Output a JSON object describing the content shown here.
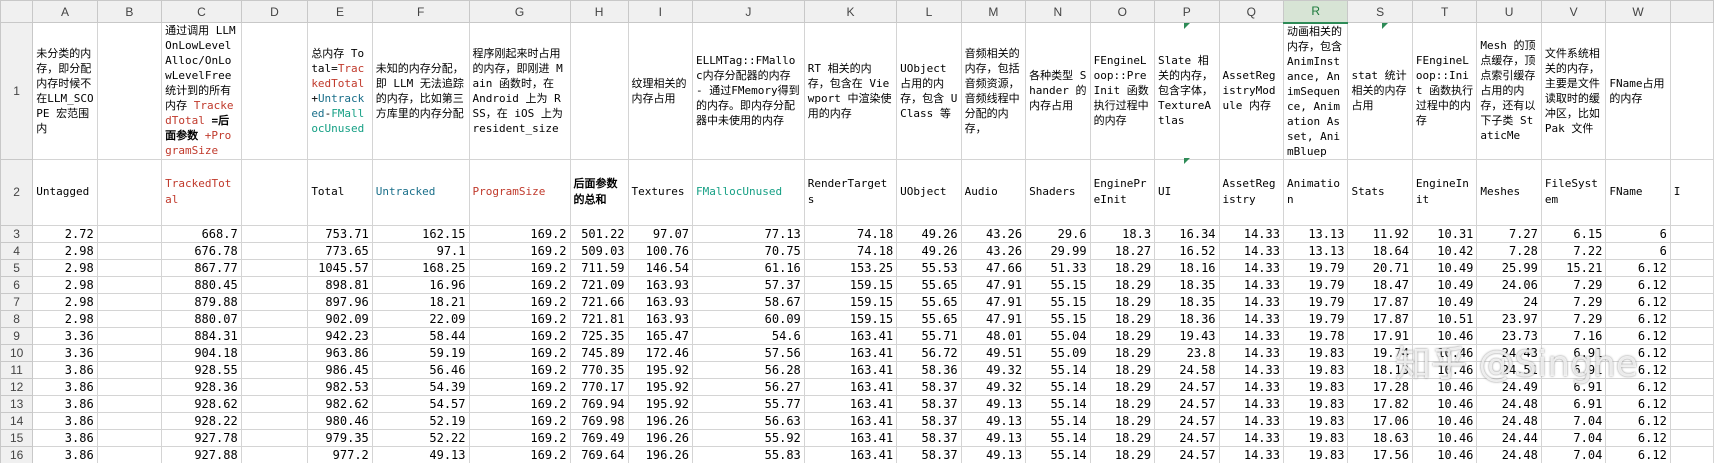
{
  "columns": [
    "A",
    "B",
    "C",
    "D",
    "E",
    "F",
    "G",
    "H",
    "I",
    "J",
    "K",
    "L",
    "M",
    "N",
    "O",
    "P",
    "Q",
    "R",
    "S",
    "T",
    "U",
    "V",
    "W",
    ""
  ],
  "row1": [
    {
      "text": "未分类的内存，即分配内存时候不在LLM_SCOPE 宏范围内"
    },
    {
      "text": ""
    },
    {
      "text": "通过调用 LLM OnLowLevelAlloc/OnLowLevelFree 统计到的所有内存",
      "parts": [
        {
          "t": "通过调用 LLM OnLowLevelAlloc/OnLowLevelFree 统计到的所有内存 ",
          "c": ""
        },
        {
          "t": "TrackedTotal",
          "c": "red"
        },
        {
          "t": " =后面参数",
          "c": "bold"
        },
        {
          "t": " +ProgramSize",
          "c": "red"
        }
      ]
    },
    {
      "text": ""
    },
    {
      "text": "",
      "parts": [
        {
          "t": "总内存 Total=",
          "c": ""
        },
        {
          "t": "TrackedTotal",
          "c": "red"
        },
        {
          "t": "+",
          "c": ""
        },
        {
          "t": "Untracked",
          "c": "teal"
        },
        {
          "t": "-",
          "c": ""
        },
        {
          "t": "FMallocUnused",
          "c": "green"
        }
      ]
    },
    {
      "text": "未知的内存分配，即 LLM 无法追踪的内存，比如第三方库里的内存分配"
    },
    {
      "text": "程序刚起来时占用的内存，即刚进 Main 函数时，在 Android 上为 RSS，在 iOS 上为 resident_size"
    },
    {
      "text": ""
    },
    {
      "text": "纹理相关的内存占用"
    },
    {
      "text": "ELLMTag::FMalloc内存分配器的内存 - 通过FMemory得到的内存。即内存分配器中未使用的内存"
    },
    {
      "text": " RT 相关的内存，包含在 Viewport 中渲染使用的内存"
    },
    {
      "text": "UObject 占用的内存，包含 UClass 等"
    },
    {
      "text": "音频相关的内存，包括音频资源，音频线程中分配的内存，"
    },
    {
      "text": "各种类型 Shander 的内存占用"
    },
    {
      "text": "FEngineLoop::PreInit 函数执行过程中的内存"
    },
    {
      "text": "Slate 相关的内存，包含字体，TextureAtlas"
    },
    {
      "text": "AssetRegistryModule 内存"
    },
    {
      "text": "动画相关的内存，包含 AnimInstance, AnimSequence, Animation Asset, AnimBluep"
    },
    {
      "text": "stat 统计相关的内存占用"
    },
    {
      "text": "FEngineLoop::Init 函数执行过程中的内存"
    },
    {
      "text": " Mesh 的顶点缓存，顶点索引缓存占用的内存，还有以下子类 StaticMe"
    },
    {
      "text": "文件系统相关的内存，主要是文件读取时的缓冲区，比如Pak 文件"
    },
    {
      "text": "FName占用的内存"
    },
    {
      "text": ""
    }
  ],
  "row2": [
    {
      "text": "Untagged",
      "c": ""
    },
    {
      "text": "",
      "c": ""
    },
    {
      "text": "TrackedTotal",
      "c": "red"
    },
    {
      "text": "",
      "c": ""
    },
    {
      "text": "Total",
      "c": ""
    },
    {
      "text": "Untracked",
      "c": "teal"
    },
    {
      "text": "ProgramSize",
      "c": "red"
    },
    {
      "text": "后面参数的总和",
      "c": "bold"
    },
    {
      "text": "Textures",
      "c": ""
    },
    {
      "text": "FMallocUnused",
      "c": "green"
    },
    {
      "text": "RenderTargets",
      "c": ""
    },
    {
      "text": "UObject",
      "c": ""
    },
    {
      "text": "Audio",
      "c": ""
    },
    {
      "text": "Shaders",
      "c": ""
    },
    {
      "text": "EnginePreInit",
      "c": ""
    },
    {
      "text": "UI",
      "c": ""
    },
    {
      "text": "AssetRegistry",
      "c": ""
    },
    {
      "text": "Animation",
      "c": ""
    },
    {
      "text": "Stats",
      "c": ""
    },
    {
      "text": "EngineInit",
      "c": ""
    },
    {
      "text": "Meshes",
      "c": ""
    },
    {
      "text": "FileSystem",
      "c": ""
    },
    {
      "text": "FName",
      "c": ""
    },
    {
      "text": "I",
      "c": ""
    }
  ],
  "rows": [
    {
      "n": "3",
      "cells": [
        "2.72",
        "",
        "668.7",
        "",
        "753.71",
        "162.15",
        "169.2",
        "501.22",
        "97.07",
        "77.13",
        "74.18",
        "49.26",
        "43.26",
        "29.6",
        "18.3",
        "16.34",
        "14.33",
        "13.13",
        "11.92",
        "10.31",
        "7.27",
        "6.15",
        "6",
        ""
      ]
    },
    {
      "n": "4",
      "cells": [
        "2.98",
        "",
        "676.78",
        "",
        "773.65",
        "97.1",
        "169.2",
        "509.03",
        "100.76",
        "70.75",
        "74.18",
        "49.26",
        "43.26",
        "29.99",
        "18.27",
        "16.52",
        "14.33",
        "13.13",
        "18.64",
        "10.42",
        "7.28",
        "7.22",
        "6",
        ""
      ]
    },
    {
      "n": "5",
      "cells": [
        "2.98",
        "",
        "867.77",
        "",
        "1045.57",
        "168.25",
        "169.2",
        "711.59",
        "146.54",
        "61.16",
        "153.25",
        "55.53",
        "47.66",
        "51.33",
        "18.29",
        "18.16",
        "14.33",
        "19.79",
        "20.71",
        "10.49",
        "25.99",
        "15.21",
        "6.12",
        ""
      ]
    },
    {
      "n": "6",
      "cells": [
        "2.98",
        "",
        "880.45",
        "",
        "898.81",
        "16.96",
        "169.2",
        "721.09",
        "163.93",
        "57.37",
        "159.15",
        "55.65",
        "47.91",
        "55.15",
        "18.29",
        "18.35",
        "14.33",
        "19.79",
        "18.47",
        "10.49",
        "24.06",
        "7.29",
        "6.12",
        ""
      ]
    },
    {
      "n": "7",
      "cells": [
        "2.98",
        "",
        "879.88",
        "",
        "897.96",
        "18.21",
        "169.2",
        "721.66",
        "163.93",
        "58.67",
        "159.15",
        "55.65",
        "47.91",
        "55.15",
        "18.29",
        "18.35",
        "14.33",
        "19.79",
        "17.87",
        "10.49",
        "24",
        "7.29",
        "6.12",
        ""
      ]
    },
    {
      "n": "8",
      "cells": [
        "2.98",
        "",
        "880.07",
        "",
        "902.09",
        "22.09",
        "169.2",
        "721.81",
        "163.93",
        "60.09",
        "159.15",
        "55.65",
        "47.91",
        "55.15",
        "18.29",
        "18.36",
        "14.33",
        "19.79",
        "17.87",
        "10.51",
        "23.97",
        "7.29",
        "6.12",
        ""
      ]
    },
    {
      "n": "9",
      "cells": [
        "3.36",
        "",
        "884.31",
        "",
        "942.23",
        "58.44",
        "169.2",
        "725.35",
        "165.47",
        "54.6",
        "163.41",
        "55.71",
        "48.01",
        "55.04",
        "18.29",
        "19.43",
        "14.33",
        "19.78",
        "17.91",
        "10.46",
        "23.73",
        "7.16",
        "6.12",
        ""
      ]
    },
    {
      "n": "10",
      "cells": [
        "3.36",
        "",
        "904.18",
        "",
        "963.86",
        "59.19",
        "169.2",
        "745.89",
        "172.46",
        "57.56",
        "163.41",
        "56.72",
        "49.51",
        "55.09",
        "18.29",
        "23.8",
        "14.33",
        "19.83",
        "19.74",
        "10.46",
        "24.43",
        "6.91",
        "6.12",
        ""
      ]
    },
    {
      "n": "11",
      "cells": [
        "3.86",
        "",
        "928.55",
        "",
        "986.45",
        "56.46",
        "169.2",
        "770.35",
        "195.92",
        "56.28",
        "163.41",
        "58.36",
        "49.32",
        "55.14",
        "18.29",
        "24.58",
        "14.33",
        "19.83",
        "18.13",
        "10.46",
        "24.51",
        "6.91",
        "6.12",
        ""
      ]
    },
    {
      "n": "12",
      "cells": [
        "3.86",
        "",
        "928.36",
        "",
        "982.53",
        "54.39",
        "169.2",
        "770.17",
        "195.92",
        "56.27",
        "163.41",
        "58.37",
        "49.32",
        "55.14",
        "18.29",
        "24.57",
        "14.33",
        "19.83",
        "17.28",
        "10.46",
        "24.49",
        "6.91",
        "6.12",
        ""
      ]
    },
    {
      "n": "13",
      "cells": [
        "3.86",
        "",
        "928.62",
        "",
        "982.62",
        "54.57",
        "169.2",
        "769.94",
        "195.92",
        "55.77",
        "163.41",
        "58.37",
        "49.13",
        "55.14",
        "18.29",
        "24.57",
        "14.33",
        "19.83",
        "17.82",
        "10.46",
        "24.48",
        "6.91",
        "6.12",
        ""
      ]
    },
    {
      "n": "14",
      "cells": [
        "3.86",
        "",
        "928.22",
        "",
        "980.46",
        "52.19",
        "169.2",
        "769.98",
        "196.26",
        "56.63",
        "163.41",
        "58.37",
        "49.13",
        "55.14",
        "18.29",
        "24.57",
        "14.33",
        "19.83",
        "17.06",
        "10.46",
        "24.48",
        "7.04",
        "6.12",
        ""
      ]
    },
    {
      "n": "15",
      "cells": [
        "3.86",
        "",
        "927.78",
        "",
        "979.35",
        "52.22",
        "169.2",
        "769.49",
        "196.26",
        "55.92",
        "163.41",
        "58.37",
        "49.13",
        "55.14",
        "18.29",
        "24.57",
        "14.33",
        "19.83",
        "18.63",
        "10.46",
        "24.44",
        "7.04",
        "6.12",
        ""
      ]
    },
    {
      "n": "16",
      "cells": [
        "3.86",
        "",
        "927.88",
        "",
        "977.2",
        "49.13",
        "169.2",
        "769.64",
        "196.26",
        "55.83",
        "163.41",
        "58.37",
        "49.13",
        "55.14",
        "18.29",
        "24.57",
        "14.33",
        "19.83",
        "17.56",
        "10.46",
        "24.48",
        "7.04",
        "6.12",
        ""
      ]
    }
  ],
  "watermark": "知乎 @Singhe"
}
